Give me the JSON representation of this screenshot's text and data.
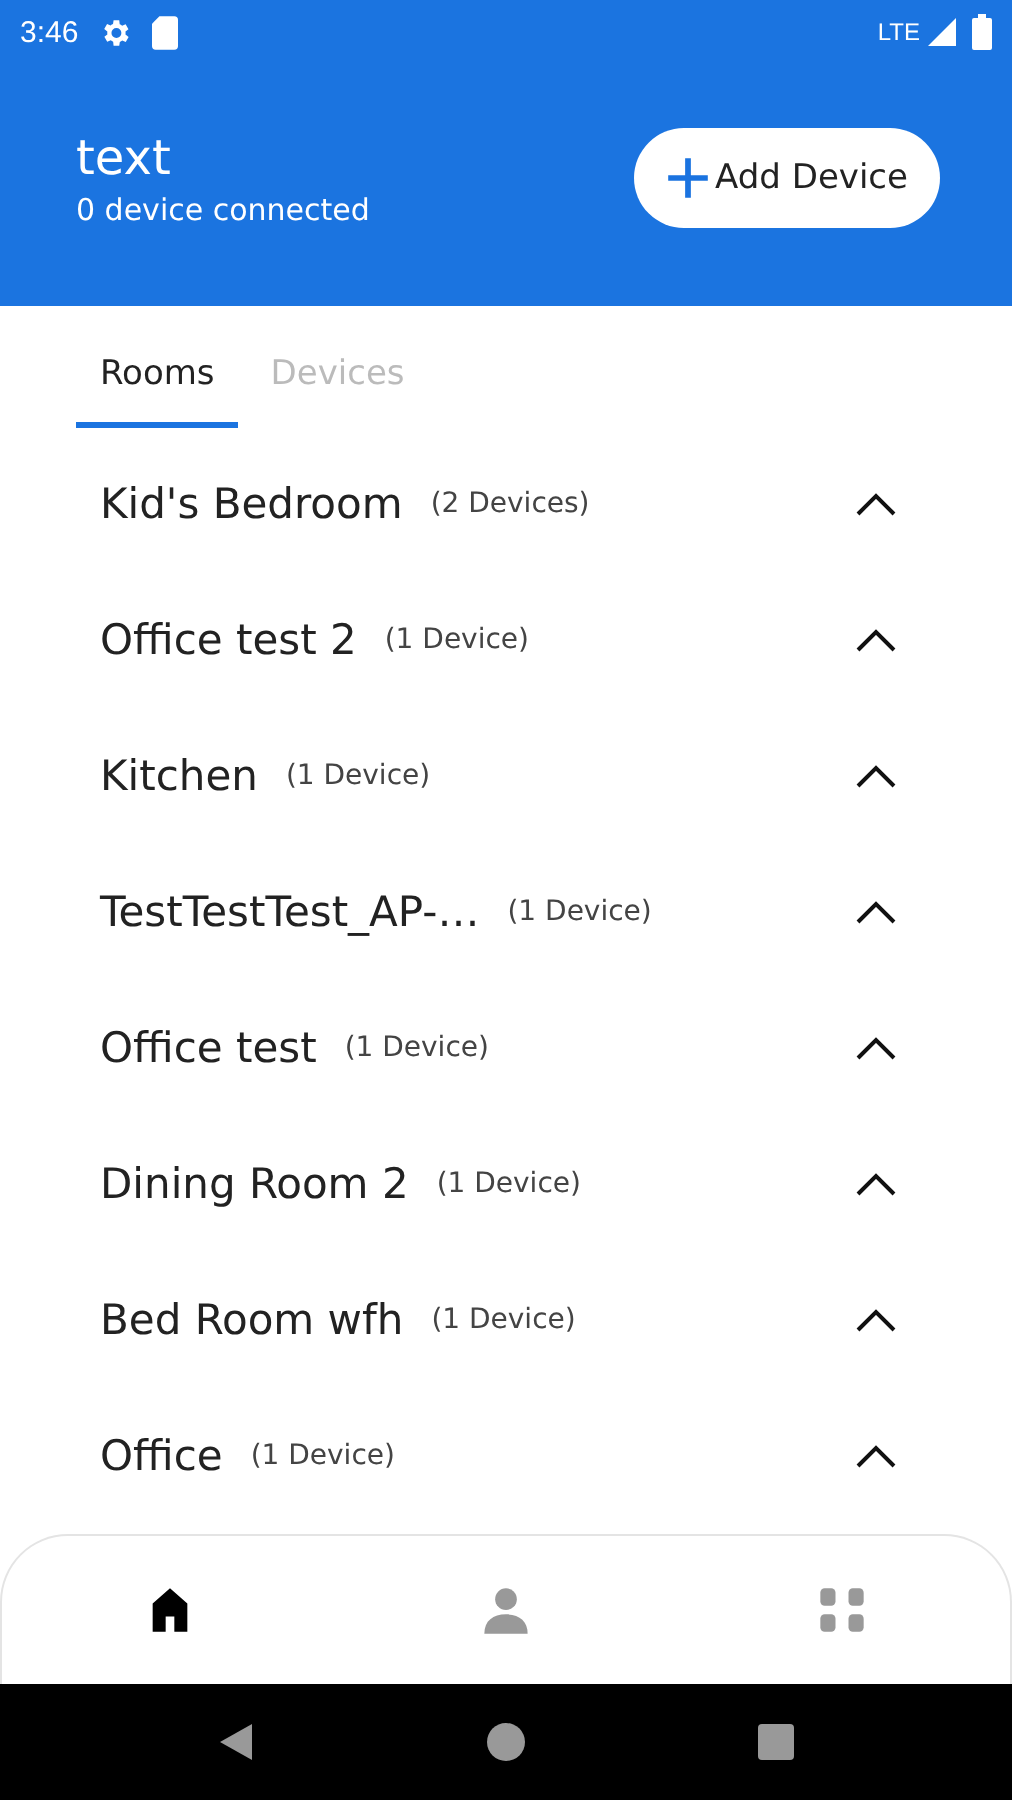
{
  "status_bar": {
    "time": "3:46",
    "network": "LTE"
  },
  "header": {
    "title": "text",
    "subtitle": "0 device connected",
    "add_button": "Add Device"
  },
  "tabs": [
    {
      "label": "Rooms",
      "selected": true
    },
    {
      "label": "Devices",
      "selected": false
    }
  ],
  "rooms": [
    {
      "name": "Kid's Bedroom",
      "count": "(2 Devices)"
    },
    {
      "name": "Office test 2",
      "count": "(1 Device)"
    },
    {
      "name": "Kitchen",
      "count": "(1 Device)"
    },
    {
      "name": "TestTestTest_AP-…",
      "count": "(1 Device)"
    },
    {
      "name": "Office test",
      "count": "(1 Device)"
    },
    {
      "name": "Dining Room 2",
      "count": "(1 Device)"
    },
    {
      "name": "Bed Room wfh",
      "count": "(1 Device)"
    },
    {
      "name": "Office",
      "count": "(1 Device)"
    }
  ],
  "bottom_nav": [
    {
      "kind": "home",
      "selected": true
    },
    {
      "kind": "profile",
      "selected": false
    },
    {
      "kind": "apps",
      "selected": false
    }
  ]
}
